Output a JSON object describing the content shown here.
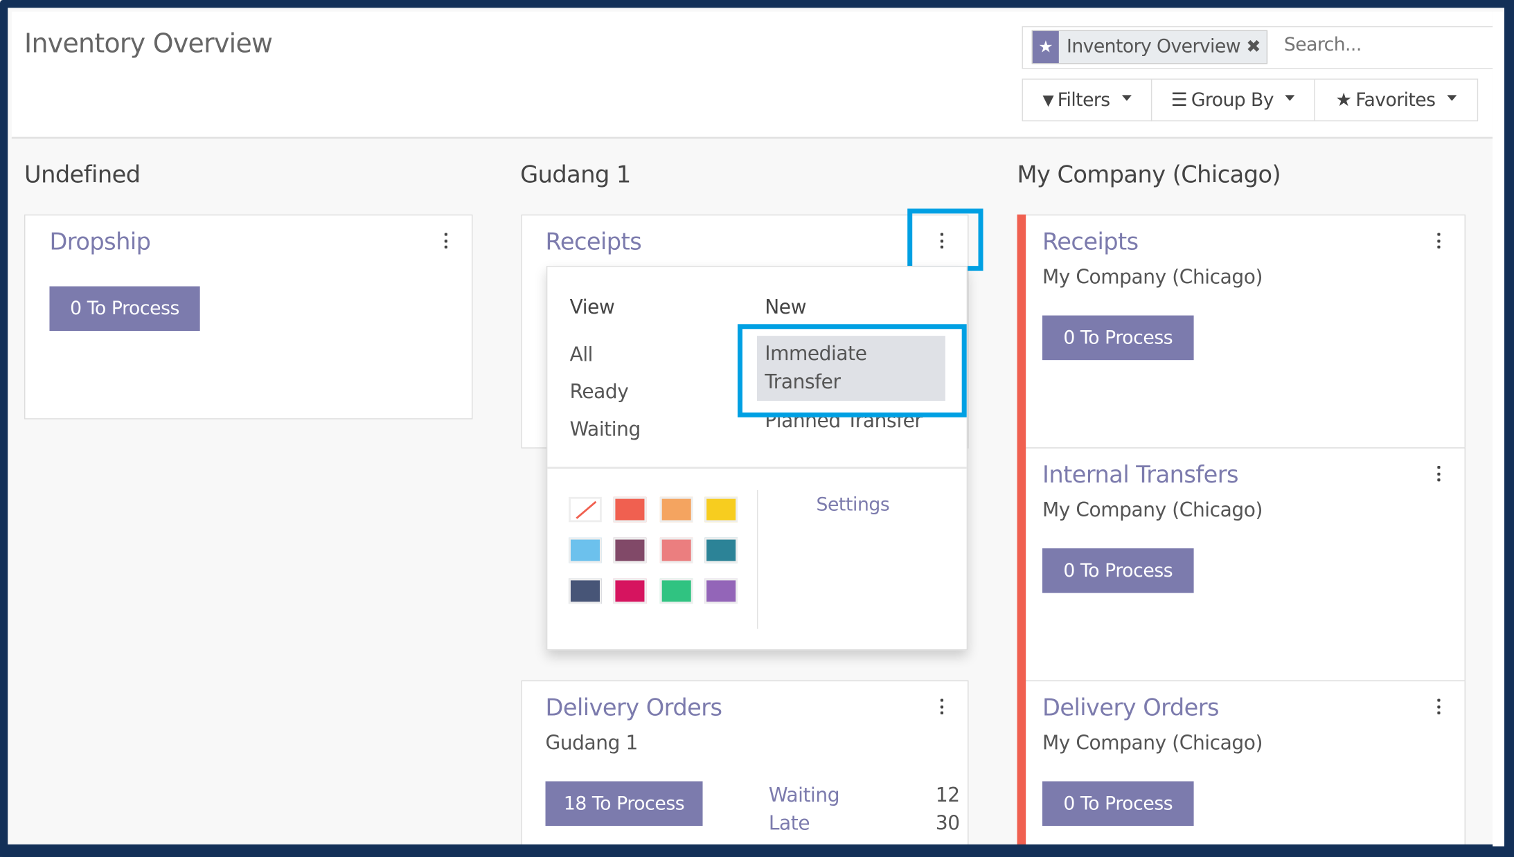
{
  "header": {
    "title": "Inventory Overview"
  },
  "search": {
    "facet_label": "Inventory Overview",
    "facet_icon": "star-icon",
    "placeholder": "Search..."
  },
  "toolbar": {
    "filters": "Filters",
    "group_by": "Group By",
    "favorites": "Favorites"
  },
  "columns": [
    {
      "name": "Undefined",
      "cards": [
        {
          "title": "Dropship",
          "button": "0 To Process"
        }
      ]
    },
    {
      "name": "Gudang 1",
      "cards": [
        {
          "title": "Receipts"
        },
        {
          "title": "Delivery Orders",
          "subtitle": "Gudang 1",
          "button": "18 To Process",
          "stats": [
            {
              "label": "Waiting",
              "value": "12"
            },
            {
              "label": "Late",
              "value": "30"
            }
          ]
        }
      ]
    },
    {
      "name": "My Company (Chicago)",
      "cards": [
        {
          "title": "Receipts",
          "subtitle": "My Company (Chicago)",
          "button": "0 To Process"
        },
        {
          "title": "Internal Transfers",
          "subtitle": "My Company (Chicago)",
          "button": "0 To Process"
        },
        {
          "title": "Delivery Orders",
          "subtitle": "My Company (Chicago)",
          "button": "0 To Process"
        }
      ]
    }
  ],
  "dropdown": {
    "view_heading": "View",
    "view_items": [
      "All",
      "Ready",
      "Waiting"
    ],
    "new_heading": "New",
    "new_items": [
      "Immediate Transfer",
      "Planned Transfer"
    ],
    "settings": "Settings",
    "colors": [
      "none",
      "#f06050",
      "#f4a460",
      "#f7cd1f",
      "#6cc1ed",
      "#814968",
      "#eb7e7f",
      "#2c8397",
      "#475577",
      "#d6145f",
      "#30c381",
      "#9365b8"
    ]
  },
  "theme": {
    "accent": "#7c7bad",
    "highlight": "#00a0e3",
    "card_color": "#f06050",
    "frame": "#133058"
  }
}
